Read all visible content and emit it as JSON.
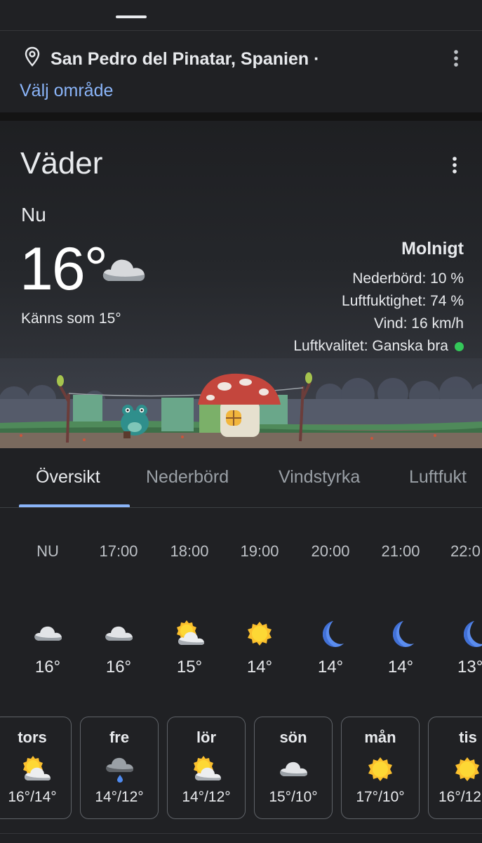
{
  "location": {
    "name": "San Pedro del Pinatar, Spanien ·",
    "change_label": "Välj område"
  },
  "weather": {
    "title": "Väder",
    "now_label": "Nu",
    "temperature": "16°",
    "current_icon": "cloudy-icon",
    "feels_like": "Känns som 15°",
    "condition": "Molnigt",
    "precipitation": "Nederbörd: 10 %",
    "humidity": "Luftfuktighet: 74 %",
    "wind": "Vind: 16 km/h",
    "air_quality": "Luftkvalitet: Ganska bra",
    "air_quality_color": "#34c759"
  },
  "tabs": [
    {
      "label": "Översikt",
      "active": true
    },
    {
      "label": "Nederbörd",
      "active": false
    },
    {
      "label": "Vindstyrka",
      "active": false
    },
    {
      "label": "Luftfukt",
      "active": false
    }
  ],
  "hourly": [
    {
      "time": "NU",
      "icon": "cloud",
      "temp": "16°"
    },
    {
      "time": "17:00",
      "icon": "cloud",
      "temp": "16°"
    },
    {
      "time": "18:00",
      "icon": "partly-sunny",
      "temp": "15°"
    },
    {
      "time": "19:00",
      "icon": "sun",
      "temp": "14°"
    },
    {
      "time": "20:00",
      "icon": "moon",
      "temp": "14°"
    },
    {
      "time": "21:00",
      "icon": "moon",
      "temp": "14°"
    },
    {
      "time": "22:0",
      "icon": "moon",
      "temp": "13°"
    }
  ],
  "daily": [
    {
      "day": "tors",
      "icon": "partly-sunny",
      "range": "16°/14°"
    },
    {
      "day": "fre",
      "icon": "rain",
      "range": "14°/12°"
    },
    {
      "day": "lör",
      "icon": "partly-sunny",
      "range": "14°/12°"
    },
    {
      "day": "sön",
      "icon": "cloud",
      "range": "15°/10°"
    },
    {
      "day": "mån",
      "icon": "sun",
      "range": "17°/10°"
    },
    {
      "day": "tis",
      "icon": "sun",
      "range": "16°/12"
    }
  ],
  "colors": {
    "background": "#202124",
    "accent": "#8ab4f8",
    "sun": "#fbc02d",
    "moon": "#5b8def"
  }
}
